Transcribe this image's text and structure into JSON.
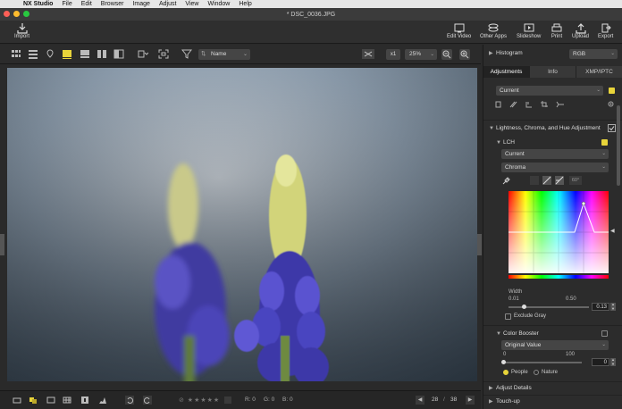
{
  "menubar": {
    "apple": "",
    "app": "NX Studio",
    "items": [
      "File",
      "Edit",
      "Browser",
      "Image",
      "Adjust",
      "View",
      "Window",
      "Help"
    ]
  },
  "window": {
    "title": "* DSC_0036.JPG"
  },
  "toolbar": {
    "import": "Import",
    "edit_video": "Edit Video",
    "other_apps": "Other Apps",
    "slideshow": "Slideshow",
    "print": "Print",
    "upload": "Upload",
    "export": "Export"
  },
  "viewbar": {
    "sort": "Name",
    "zoom": "25%",
    "ratio": "x1"
  },
  "status": {
    "r": "R: 0",
    "g": "G: 0",
    "b": "B: 0",
    "page_current": "28",
    "page_total": "38"
  },
  "panel": {
    "histogram": "Histogram",
    "histogram_mode": "RGB",
    "tabs": [
      "Adjustments",
      "Info",
      "XMP/IPTC"
    ],
    "preset": "Current",
    "lch_section": "Lightness, Chroma, and Hue Adjustment",
    "lch": "LCH",
    "lch_preset": "Current",
    "lch_channel": "Chroma",
    "angle": "60°",
    "width_label": "Width",
    "width_min": "0.01",
    "width_mid": "0.50",
    "width_value": "0.13",
    "exclude_gray": "Exclude Gray",
    "color_booster": "Color Booster",
    "booster_preset": "Original Value",
    "booster_min": "0",
    "booster_max": "100",
    "booster_value": "0",
    "people": "People",
    "nature": "Nature",
    "adjust_details": "Adjust Details",
    "touch_up": "Touch-up"
  },
  "colors": {
    "accent": "#e8d43a",
    "panel": "#2c2c2c",
    "toolbar": "#2f2f2f"
  }
}
